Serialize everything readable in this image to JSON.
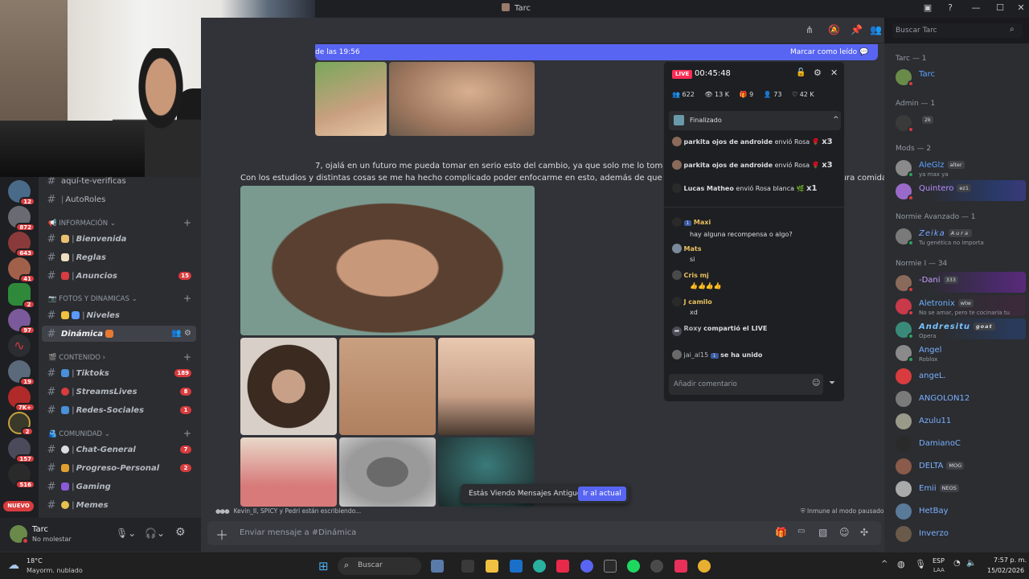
{
  "window": {
    "title": "Tarc"
  },
  "rail": {
    "badges": [
      "12",
      "872",
      "643",
      "41",
      "2",
      "97",
      "",
      "19",
      "7K+",
      "2",
      "157",
      "516",
      "",
      ""
    ],
    "new_label": "NUEVO"
  },
  "channels": {
    "top": [
      {
        "label": "aquí-te-verificas"
      },
      {
        "label": "AutoRoles"
      }
    ],
    "cat_info": "INFORMACIÓN",
    "info": [
      {
        "label": "Bienvenida",
        "count": ""
      },
      {
        "label": "Reglas",
        "count": ""
      },
      {
        "label": "Anuncios",
        "count": "15"
      }
    ],
    "cat_fotos": "FOTOS Y DINAMICAS",
    "fotos": [
      {
        "label": "Niveles",
        "count": ""
      },
      {
        "label": "Dinámica",
        "count": ""
      }
    ],
    "cat_contenido": "CONTENIDO",
    "contenido": [
      {
        "label": "Tiktoks",
        "count": "189"
      },
      {
        "label": "StreamsLives",
        "count": "8"
      },
      {
        "label": "Redes-Sociales",
        "count": "1"
      }
    ],
    "cat_comunidad": "COMUNIDAD",
    "comunidad": [
      {
        "label": "Chat-General",
        "count": "7"
      },
      {
        "label": "Progreso-Personal",
        "count": "2"
      },
      {
        "label": "Gaming",
        "count": ""
      },
      {
        "label": "Memes",
        "count": ""
      }
    ]
  },
  "user": {
    "name": "Tarc",
    "status": "No molestar"
  },
  "newbar": {
    "text": "de las 19:56",
    "action": "Marcar como leído"
  },
  "messages": {
    "line1": "7, ojalá en un futuro me pueda tomar en serio esto del cambio, ya que solo me lo tomé en serio 2 se",
    "line2": "Con los estudios y distintas cosas se me ha hecho complicado poder enfocarme en esto, además de que de por si no me gusta tomar agua y como pura comida chatarra.",
    "typing": "Kevin_II, SPICY y Pedri están escribiendo...",
    "muted": "Inmune al modo pausado",
    "old_notice": "Estás Viendo Mensajes Antiguos",
    "jump": "Ir al actual",
    "input_placeholder": "Enviar mensaje a #Dinámica"
  },
  "search": {
    "placeholder": "Buscar Tarc"
  },
  "live": {
    "badge": "LIVE",
    "time": "00:45:48",
    "stats": [
      "622",
      "13 K",
      "9",
      "73",
      "42 K"
    ],
    "finalizado": "Finalizado",
    "gifts": [
      {
        "user": "parkita ojos de androide",
        "text": "envió Rosa",
        "mult": "x3"
      },
      {
        "user": "parkita ojos de androide",
        "text": "envió Rosa",
        "mult": "x3"
      },
      {
        "user": "Lucas Matheo",
        "text": "envió Rosa blanca",
        "mult": "x1"
      }
    ],
    "comments": [
      {
        "user": "Maxi",
        "level": "1",
        "text": "hay alguna recompensa o algo?"
      },
      {
        "user": "Mats",
        "level": "",
        "text": "si"
      },
      {
        "user": "Cris mj",
        "level": "",
        "text": "👍👍👍👍"
      },
      {
        "user": "J camilo",
        "level": "",
        "text": "xd"
      }
    ],
    "share": {
      "user": "Roxy",
      "text": "compartió el LIVE"
    },
    "joined": {
      "user": "jai_al15",
      "level": "1",
      "text": "se ha unido"
    },
    "input_placeholder": "Añadir comentario"
  },
  "members": {
    "groups": [
      {
        "title": "Tarc — 1",
        "items": [
          {
            "name": "Tarc",
            "sub": "",
            "tag": "",
            "color": "#5865f2"
          }
        ]
      },
      {
        "title": "Admin — 1",
        "items": [
          {
            "name": "",
            "sub": "",
            "tag": "2k",
            "color": "#dbdee1"
          }
        ]
      },
      {
        "title": "Mods — 2",
        "items": [
          {
            "name": "AleGlz",
            "sub": "ya max ya",
            "tag": "alter",
            "color": "#5ea2ff"
          },
          {
            "name": "Quintero",
            "sub": "",
            "tag": "ez1",
            "color": "#b98dff"
          }
        ]
      },
      {
        "title": "Normie Avanzado — 1",
        "items": [
          {
            "name": "Zeika",
            "sub": "Tu genética no importa",
            "tag": "Aura",
            "color": "#7aa6ff"
          }
        ]
      },
      {
        "title": "Normie I — 34",
        "items": [
          {
            "name": "-Dani",
            "sub": "",
            "tag": "333",
            "color": "#c9a0ff"
          },
          {
            "name": "Aletronix",
            "sub": "No se amar, pero te cocinaría tu",
            "tag": "wtw",
            "color": "#6fb3ff"
          },
          {
            "name": "Andresitu",
            "sub": "Opera",
            "tag": "goat",
            "color": "#78c2ff"
          },
          {
            "name": "Angel",
            "sub": "Roblox",
            "tag": "",
            "color": "#7ab0ff"
          },
          {
            "name": "angeL.",
            "sub": "",
            "tag": "",
            "color": "#7ab0ff"
          },
          {
            "name": "ANGOLON12",
            "sub": "",
            "tag": "",
            "color": "#7ab0ff"
          },
          {
            "name": "Azulu11",
            "sub": "",
            "tag": "",
            "color": "#7ab0ff"
          },
          {
            "name": "DamianoC",
            "sub": "",
            "tag": "",
            "color": "#7ab0ff"
          },
          {
            "name": "DELTA",
            "sub": "",
            "tag": "MOG",
            "color": "#7ab0ff"
          },
          {
            "name": "Emii",
            "sub": "",
            "tag": "NEOS",
            "color": "#7ab0ff"
          },
          {
            "name": "HetBay",
            "sub": "",
            "tag": "",
            "color": "#7ab0ff"
          },
          {
            "name": "Inverzo",
            "sub": "",
            "tag": "",
            "color": "#7ab0ff"
          }
        ]
      }
    ]
  },
  "taskbar": {
    "weather_temp": "18°C",
    "weather_desc": "Mayorm. nublado",
    "search": "Buscar",
    "lang": "ESP",
    "lang2": "LAA",
    "time": "7:57 p. m.",
    "date": "15/02/2026"
  }
}
